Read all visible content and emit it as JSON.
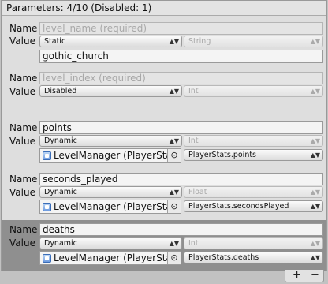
{
  "header": {
    "title": "Parameters: 4/10 (Disabled: 1)"
  },
  "labels": {
    "name": "Name",
    "value": "Value"
  },
  "parameters": [
    {
      "name": "level_name (required)",
      "mode": "Static",
      "type": "String",
      "value": "gothic_church"
    },
    {
      "name": "level_index (required)",
      "mode": "Disabled",
      "type": "Int"
    },
    {
      "name": "points",
      "mode": "Dynamic",
      "type": "Int",
      "object": "LevelManager (PlayerStats)",
      "property": "PlayerStats.points"
    },
    {
      "name": "seconds_played",
      "mode": "Dynamic",
      "type": "Float",
      "object": "LevelManager (PlayerStats)",
      "property": "PlayerStats.secondsPlayed"
    },
    {
      "name": "deaths",
      "mode": "Dynamic",
      "type": "Int",
      "object": "LevelManager (PlayerStats)",
      "property": "PlayerStats.deaths"
    }
  ],
  "footer": {
    "add": "+",
    "remove": "−"
  },
  "icons": {
    "dropdown": "dropdown-arrow-icon",
    "picker": "object-picker-icon",
    "object": "script-object-icon"
  }
}
